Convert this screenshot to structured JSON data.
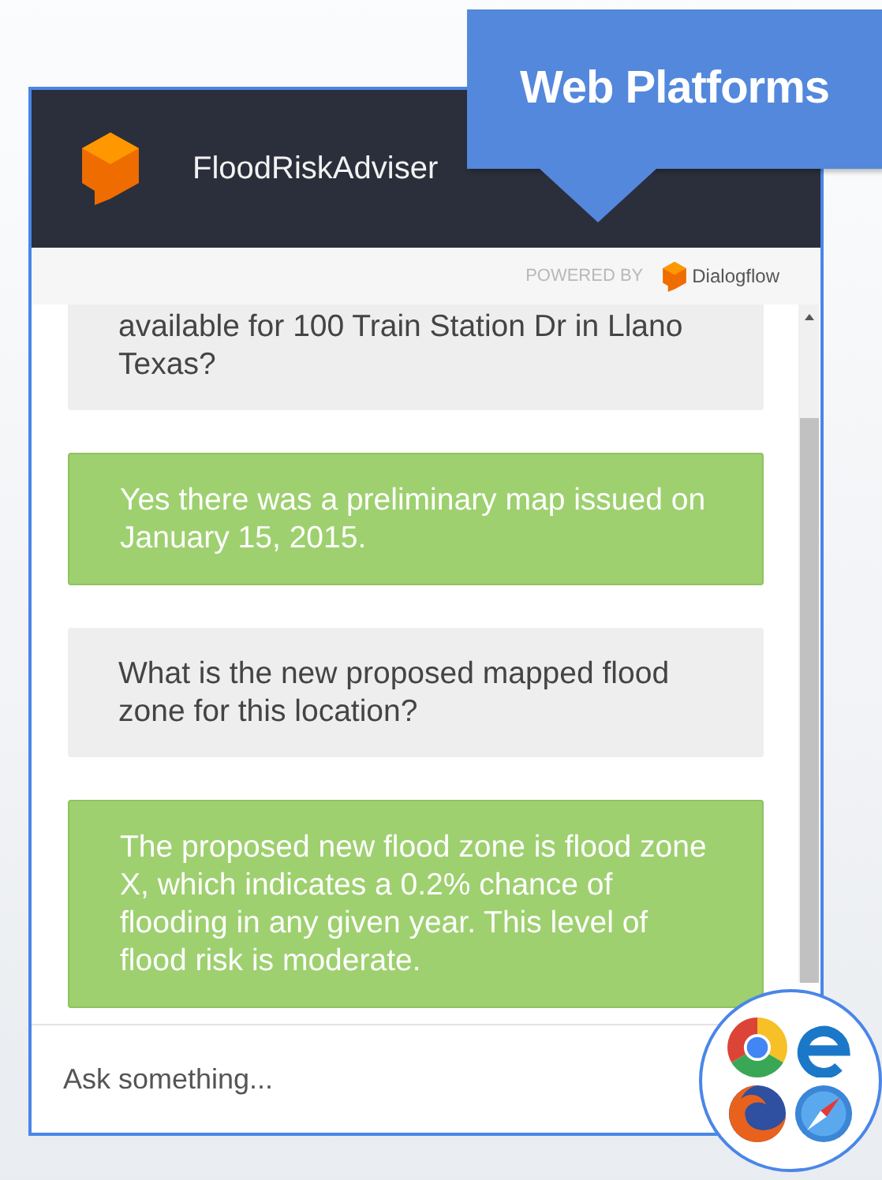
{
  "callout": {
    "label": "Web Platforms"
  },
  "chat": {
    "title": "FloodRiskAdviser",
    "powered_by": {
      "label": "POWERED BY",
      "brand": "Dialogflow"
    },
    "messages": [
      {
        "kind": "user",
        "text": "available for 100 Train Station Dr in Llano Texas?"
      },
      {
        "kind": "bot",
        "text": "Yes there was a preliminary map issued on January 15, 2015."
      },
      {
        "kind": "user",
        "text": "What is the new proposed mapped flood zone for this location?"
      },
      {
        "kind": "bot",
        "text": "The proposed new flood zone is flood zone X, which indicates a 0.2% chance of flooding in any given year. This level of flood risk is moderate."
      }
    ],
    "input": {
      "placeholder": "Ask something..."
    }
  }
}
